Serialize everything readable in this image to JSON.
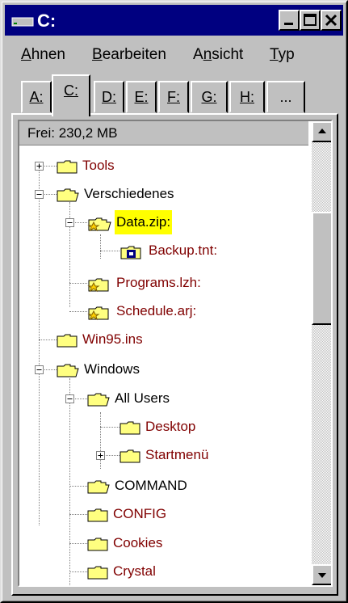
{
  "window": {
    "title": "C:"
  },
  "menu": [
    "Ahnen",
    "Bearbeiten",
    "Ansicht",
    "Typ"
  ],
  "menu_accel": [
    "A",
    "B",
    "n",
    "T"
  ],
  "tabs": [
    "A:",
    "C:",
    "D:",
    "E:",
    "F:",
    "G:",
    "H:",
    "..."
  ],
  "active_tab": "C:",
  "free_space": "Frei: 230,2 MB",
  "tree": [
    {
      "label": "Tools"
    },
    {
      "label": "Verschiedenes"
    },
    {
      "label": "Data.zip:"
    },
    {
      "label": "Backup.tnt:"
    },
    {
      "label": "Programs.lzh:"
    },
    {
      "label": "Schedule.arj:"
    },
    {
      "label": "Win95.ins"
    },
    {
      "label": "Windows"
    },
    {
      "label": "All Users"
    },
    {
      "label": "Desktop"
    },
    {
      "label": "Startmenü"
    },
    {
      "label": "COMMAND"
    },
    {
      "label": "CONFIG"
    },
    {
      "label": "Cookies"
    },
    {
      "label": "Crystal"
    }
  ],
  "colors": {
    "title_bar": "#000080",
    "link_red": "#800000",
    "highlight": "#ffff00",
    "face": "#c0c0c0"
  }
}
